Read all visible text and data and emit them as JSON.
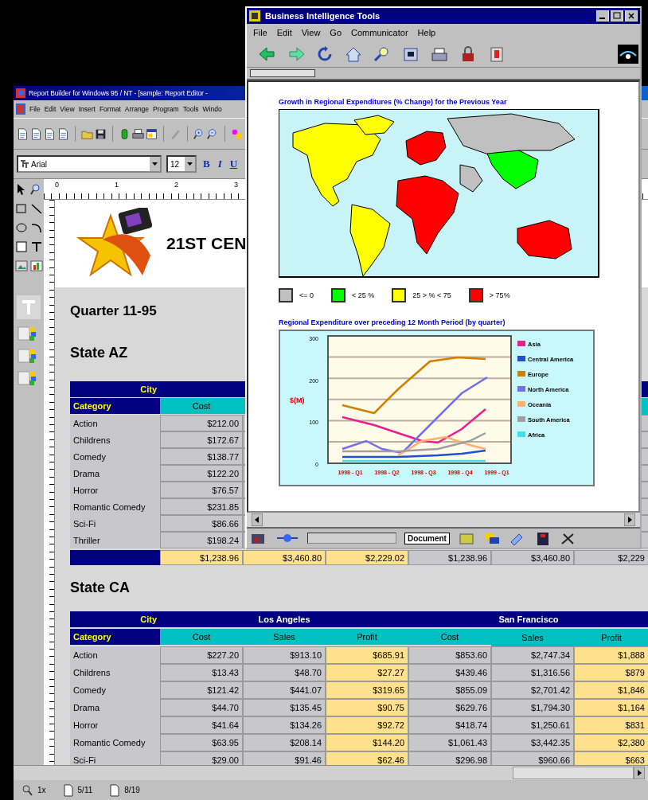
{
  "report_window": {
    "title": "Report Builder for Windows 95 / NT - [sample: Report Editor -",
    "menu": [
      "File",
      "Edit",
      "View",
      "Insert",
      "Format",
      "Arrange",
      "Program",
      "Tools",
      "Windo"
    ],
    "font_field": {
      "value": "Arial"
    },
    "size_field": {
      "value": "12"
    },
    "format_buttons": [
      "B",
      "I",
      "U"
    ],
    "ruler_marks": [
      "0",
      "1",
      "2",
      "3"
    ],
    "logo_text": "21ST CEN",
    "heading": "Quarter 11-95",
    "sections": [
      {
        "title": "State AZ",
        "city_label": "City",
        "category_label": "Category",
        "columns": [
          {
            "label": "Cost",
            "highlight": false
          }
        ],
        "rows": [
          {
            "category": "Action",
            "values": [
              "$212.00"
            ]
          },
          {
            "category": "Childrens",
            "values": [
              "$172.67"
            ]
          },
          {
            "category": "Comedy",
            "values": [
              "$138.77"
            ]
          },
          {
            "category": "Drama",
            "values": [
              "$122.20"
            ]
          },
          {
            "category": "Horror",
            "values": [
              "$76.57"
            ]
          },
          {
            "category": "Romantic Comedy",
            "values": [
              "$231.85"
            ]
          },
          {
            "category": "Sci-Fi",
            "values": [
              "$86.66"
            ]
          },
          {
            "category": "Thriller",
            "values": [
              "$198.24"
            ]
          }
        ],
        "totals": [
          {
            "value": "$1,238.96",
            "highlight": true
          },
          {
            "value": "$3,460.80",
            "highlight": true
          },
          {
            "value": "$2,229.02",
            "highlight": true
          },
          {
            "value": "$1,238.96",
            "highlight": false
          },
          {
            "value": "$3,460.80",
            "highlight": false
          },
          {
            "value": "$2,229",
            "highlight": false
          }
        ]
      },
      {
        "title": "State CA",
        "city_label": "City",
        "category_label": "Category",
        "cities": [
          "Los Angeles",
          "San Francisco"
        ],
        "columns": [
          {
            "label": "Cost",
            "highlight": false
          },
          {
            "label": "Sales",
            "highlight": false
          },
          {
            "label": "Profit",
            "highlight": true
          },
          {
            "label": "Cost",
            "highlight": false
          },
          {
            "label": "Sales",
            "highlight": false
          },
          {
            "label": "Profit",
            "highlight": true
          }
        ],
        "rows": [
          {
            "category": "Action",
            "values": [
              "$227.20",
              "$913.10",
              "$685.91",
              "$853.60",
              "$2,747.34",
              "$1,888"
            ]
          },
          {
            "category": "Childrens",
            "values": [
              "$13.43",
              "$48.70",
              "$27.27",
              "$439.46",
              "$1,316.56",
              "$879"
            ]
          },
          {
            "category": "Comedy",
            "values": [
              "$121.42",
              "$441.07",
              "$319.65",
              "$855.09",
              "$2,701.42",
              "$1,846"
            ]
          },
          {
            "category": "Drama",
            "values": [
              "$44.70",
              "$135.45",
              "$90.75",
              "$629.76",
              "$1,794.30",
              "$1,164"
            ]
          },
          {
            "category": "Horror",
            "values": [
              "$41.64",
              "$134.26",
              "$92.72",
              "$418.74",
              "$1,250.61",
              "$831"
            ]
          },
          {
            "category": "Romantic Comedy",
            "values": [
              "$63.95",
              "$208.14",
              "$144.20",
              "$1,061.43",
              "$3,442.35",
              "$2,380"
            ]
          },
          {
            "category": "Sci-Fi",
            "values": [
              "$29.00",
              "$91.46",
              "$62.46",
              "$296.98",
              "$960.66",
              "$663"
            ]
          }
        ]
      }
    ],
    "status": {
      "zoom": "1x",
      "pages": [
        "5/11",
        "8/19"
      ]
    }
  },
  "browser_window": {
    "title": "Business Intelligence Tools",
    "menu": [
      "File",
      "Edit",
      "View",
      "Go",
      "Communicator",
      "Help"
    ],
    "map_title": "Growth in Regional Expenditures (% Change) for the Previous Year",
    "legend": [
      {
        "label": "<= 0",
        "color": "#c0c0c0"
      },
      {
        "label": "< 25 %",
        "color": "#00ff00"
      },
      {
        "label": "25 > % < 75",
        "color": "#ffff00"
      },
      {
        "label": "> 75%",
        "color": "#ff0000"
      }
    ],
    "chart_title": "Regional Expenditure over preceding 12 Month Period (by quarter)",
    "chart": {
      "ylabel": "$(M)",
      "yticks": [
        "300",
        "200",
        "100",
        "0"
      ],
      "xticks": [
        "1998 - Q1",
        "1998 - Q2",
        "1998 - Q3",
        "1998 - Q4",
        "1999 - Q1"
      ],
      "legend": [
        {
          "label": "Asia",
          "color": "#e8208c"
        },
        {
          "label": "Central America",
          "color": "#2050d0"
        },
        {
          "label": "Europe",
          "color": "#d08000"
        },
        {
          "label": "North America",
          "color": "#7070f0"
        },
        {
          "label": "Oceania",
          "color": "#ffb070"
        },
        {
          "label": "South America",
          "color": "#a0a0a0"
        },
        {
          "label": "Africa",
          "color": "#40e0e8"
        }
      ]
    },
    "status": "Document"
  }
}
